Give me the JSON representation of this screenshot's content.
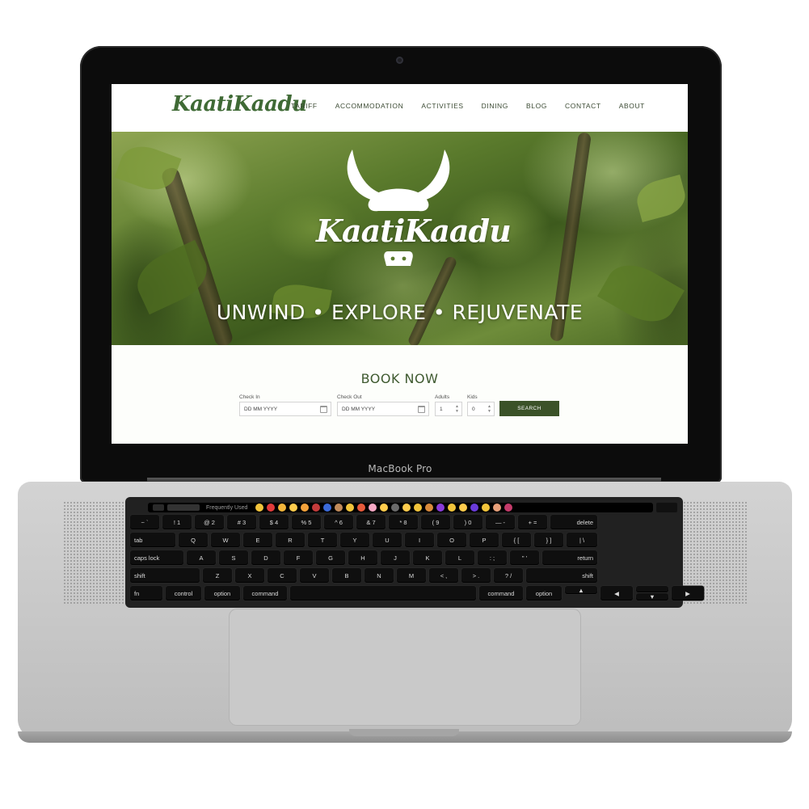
{
  "device": {
    "model_label": "MacBook Pro"
  },
  "site": {
    "logo": "KaatiKaadu",
    "nav": [
      "TARIFF",
      "ACCOMMODATION",
      "ACTIVITIES",
      "DINING",
      "BLOG",
      "CONTACT",
      "ABOUT"
    ],
    "hero": {
      "brand": "KaatiKaadu",
      "tagline": "UNWIND • EXPLORE • REJUVENATE"
    },
    "booking": {
      "title": "BOOK NOW",
      "check_in_label": "Check In",
      "check_in_value": "DD MM YYYY",
      "check_out_label": "Check Out",
      "check_out_value": "DD MM YYYY",
      "adults_label": "Adults",
      "adults_value": "1",
      "kids_label": "Kids",
      "kids_value": "0",
      "search_label": "SEARCH"
    },
    "colors": {
      "brand_green": "#3f6a35",
      "button_green": "#3b5228"
    }
  },
  "touchbar": {
    "label": "Frequently Used"
  },
  "keyboard": {
    "row_numbers": [
      "~\n`",
      "!\n1",
      "@\n2",
      "#\n3",
      "$\n4",
      "%\n5",
      "^\n6",
      "&\n7",
      "*\n8",
      "(\n9",
      ")\n0",
      "—\n-",
      "+\n=",
      "delete"
    ],
    "row_q": [
      "tab",
      "Q",
      "W",
      "E",
      "R",
      "T",
      "Y",
      "U",
      "I",
      "O",
      "P",
      "{\n[",
      "}\n]",
      "|\n\\"
    ],
    "row_a": [
      "caps lock",
      "A",
      "S",
      "D",
      "F",
      "G",
      "H",
      "J",
      "K",
      "L",
      ":\n;",
      "\"\n'",
      "return"
    ],
    "row_z": [
      "shift",
      "Z",
      "X",
      "C",
      "V",
      "B",
      "N",
      "M",
      "<\n,",
      ">\n.",
      "?\n/",
      "shift"
    ],
    "row_bottom": [
      "fn",
      "control",
      "option",
      "command",
      "",
      "command",
      "option"
    ]
  }
}
